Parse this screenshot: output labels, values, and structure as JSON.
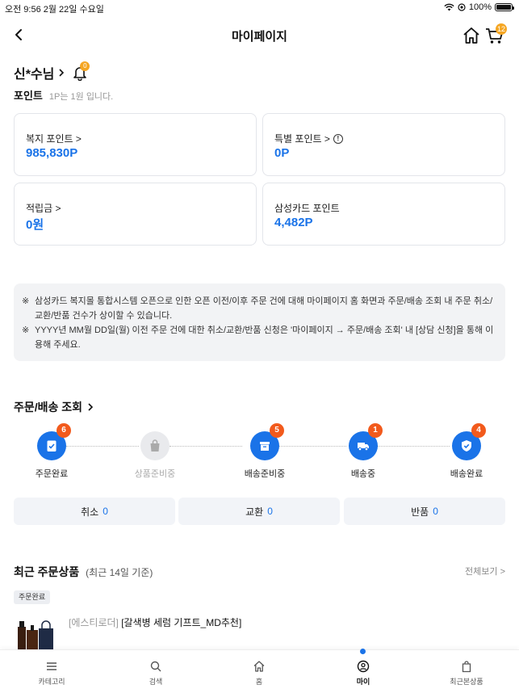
{
  "status_bar": {
    "time_date": "오전 9:56   2월 22일 수요일",
    "battery": "100%",
    "battery_level": 1.0
  },
  "nav": {
    "title": "마이페이지",
    "cart_count": "12"
  },
  "user": {
    "name": "신*수님",
    "notification_count": "0"
  },
  "points": {
    "title": "포인트",
    "subtitle": "1P는 1원 입니다.",
    "cards": [
      {
        "label": "복지 포인트 >",
        "value": "985,830P"
      },
      {
        "label": "특별 포인트 >",
        "value": "0P"
      },
      {
        "label": "적립금 >",
        "value": "0원"
      },
      {
        "label": "삼성카드 포인트",
        "value": "4,482P"
      }
    ]
  },
  "notice": {
    "mark": "※",
    "items": [
      "삼성카드 복지몰 통합시스템 오픈으로 인한 오픈 이전/이후 주문 건에 대해 마이페이지 홈 화면과 주문/배송 조회 내 주문 취소/교환/반품 건수가 상이할 수 있습니다.",
      "YYYY년 MM월 DD일(월) 이전 주문 건에 대한 취소/교환/반품 신청은 '마이페이지 → 주문/배송 조회' 내 [상담 신청]을 통해 이용해 주세요."
    ]
  },
  "orders": {
    "title": "주문/배송 조회",
    "steps": [
      {
        "label": "주문완료",
        "count": "6"
      },
      {
        "label": "상품준비중",
        "count": ""
      },
      {
        "label": "배송준비중",
        "count": "5"
      },
      {
        "label": "배송중",
        "count": "1"
      },
      {
        "label": "배송완료",
        "count": "4"
      }
    ],
    "claims": [
      {
        "label": "취소",
        "count": "0"
      },
      {
        "label": "교환",
        "count": "0"
      },
      {
        "label": "반품",
        "count": "0"
      }
    ]
  },
  "recent": {
    "title": "최근 주문상품",
    "subtitle": "(최근 14일 기준)",
    "view_all": "전체보기 >",
    "status_tag": "주문완료",
    "product_brand": "[에스티로더]",
    "product_name": "[갈색병 세럼 기프트_MD추천]"
  },
  "tabbar": {
    "items": [
      {
        "label": "카테고리",
        "icon": "menu-icon"
      },
      {
        "label": "검색",
        "icon": "search-icon"
      },
      {
        "label": "홈",
        "icon": "home-icon"
      },
      {
        "label": "마이",
        "icon": "user-icon"
      },
      {
        "label": "최근본상품",
        "icon": "shopping-bag-icon"
      }
    ]
  },
  "colors": {
    "accent": "#1a73e8",
    "badge": "#f25a1c",
    "notify": "#f5a623"
  }
}
